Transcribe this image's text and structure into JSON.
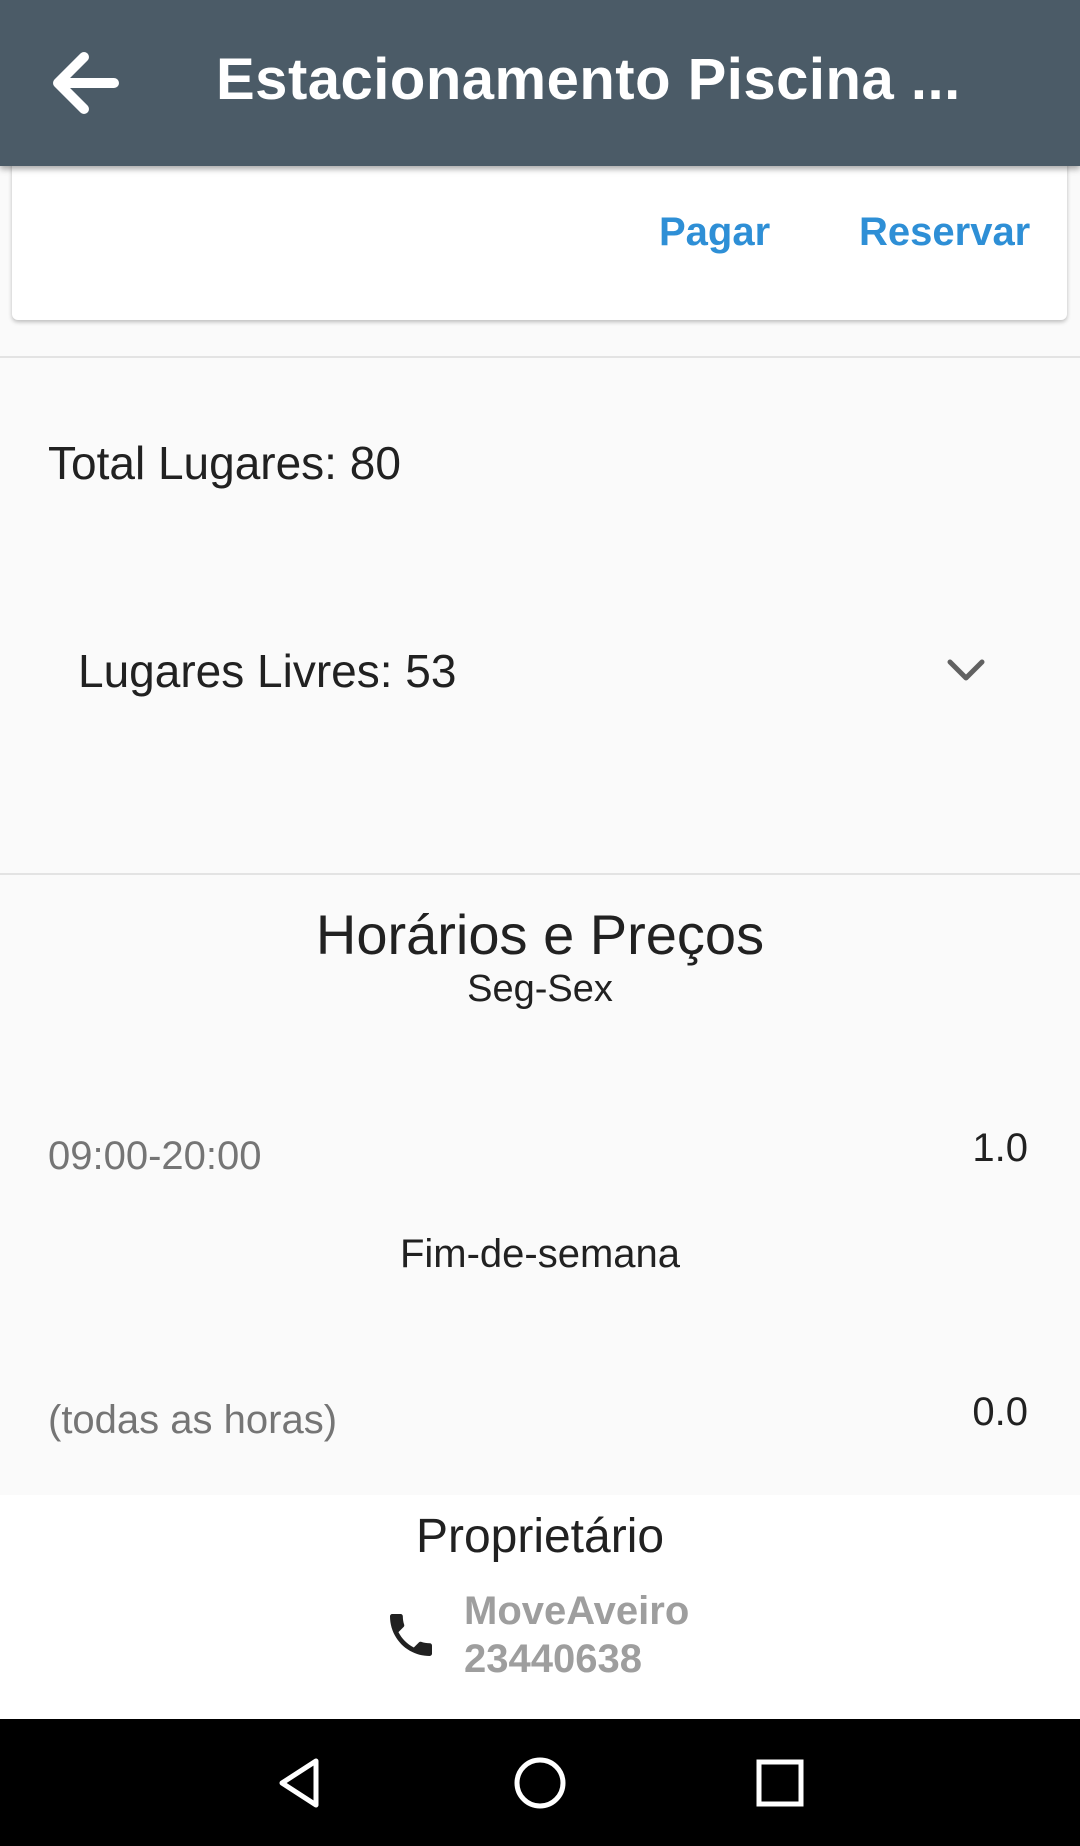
{
  "appbar": {
    "title": "Estacionamento Piscina ..."
  },
  "actions": {
    "pay_label": "Pagar",
    "reserve_label": "Reservar"
  },
  "parking": {
    "total_label": "Total Lugares: 80",
    "free_label": "Lugares Livres: 53"
  },
  "schedule": {
    "title": "Horários e Preços",
    "weekday_label": "Seg-Sex",
    "weekday_rows": [
      {
        "hours": "09:00-20:00",
        "price": "1.0"
      }
    ],
    "weekend_label": "Fim-de-semana",
    "weekend_rows": [
      {
        "hours": "(todas as horas)",
        "price": "0.0"
      }
    ]
  },
  "owner": {
    "title": "Proprietário",
    "name": "MoveAveiro",
    "phone": "23440638"
  },
  "colors": {
    "appbar": "#4b5b67",
    "accent": "#2e8fd6",
    "secondary_text": "#757575"
  },
  "icons": {
    "back": "arrow-left-icon",
    "expand": "chevron-down-icon",
    "phone": "phone-icon",
    "nav_back": "triangle-back-icon",
    "nav_home": "circle-home-icon",
    "nav_recent": "square-recent-icon"
  }
}
